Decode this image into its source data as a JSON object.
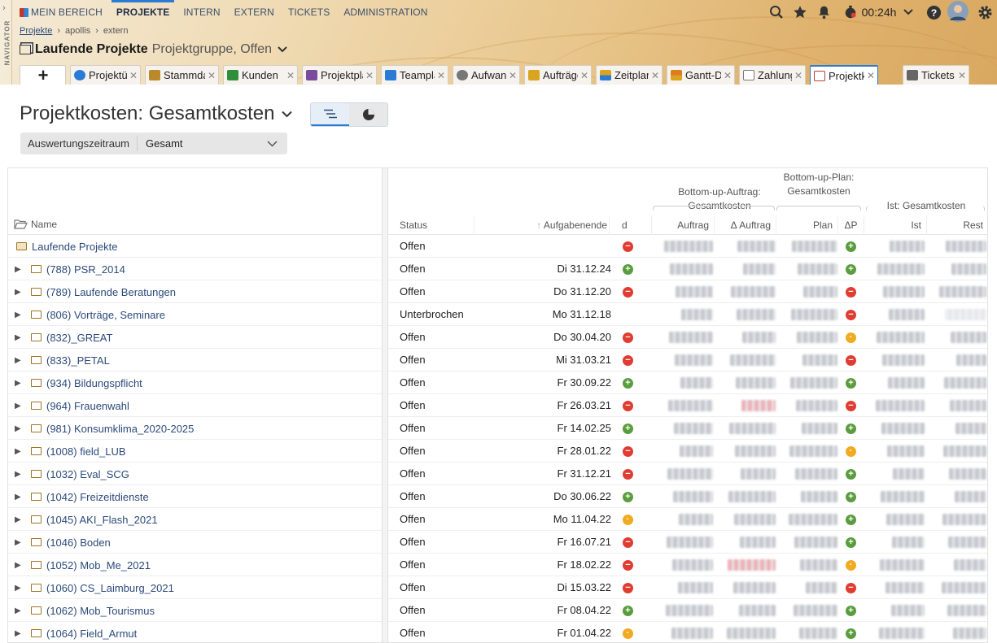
{
  "navigator": {
    "label": "NAVIGATOR"
  },
  "menu": [
    {
      "label": "MEIN BEREICH",
      "active": false
    },
    {
      "label": "PROJEKTE",
      "active": true
    },
    {
      "label": "INTERN",
      "active": false
    },
    {
      "label": "EXTERN",
      "active": false
    },
    {
      "label": "TICKETS",
      "active": false
    },
    {
      "label": "ADMINISTRATION",
      "active": false
    }
  ],
  "header_right": {
    "timer": "00:24h"
  },
  "breadcrumb": [
    "Projekte",
    "apollis",
    "extern"
  ],
  "page_title": {
    "main": "Laufende Projekte",
    "sub": "Projektgruppe, Offen"
  },
  "tabs": [
    {
      "label": "Projektüb",
      "icon": "info-icon",
      "color": "#2a7bd6"
    },
    {
      "label": "Stammdate",
      "icon": "stack-icon",
      "color": "#b9892c"
    },
    {
      "label": "Kunden",
      "icon": "building-icon",
      "color": "#2f8f3a"
    },
    {
      "label": "Projektplan",
      "icon": "tree-icon",
      "color": "#7a4a9c"
    },
    {
      "label": "Teamplan",
      "icon": "team-icon",
      "color": "#2a7bd6"
    },
    {
      "label": "Aufwand",
      "icon": "clock-icon",
      "color": "#555"
    },
    {
      "label": "Aufträge",
      "icon": "order-icon",
      "color": "#d9a520"
    },
    {
      "label": "Zeitplan",
      "icon": "schedule-icon",
      "color": "#d9a520"
    },
    {
      "label": "Gantt-Dia",
      "icon": "gantt-icon",
      "color": "#e07b1f"
    },
    {
      "label": "Zahlungen",
      "icon": "payment-icon",
      "color": "#555"
    },
    {
      "label": "Projektk",
      "icon": "cost-icon",
      "color": "#c0392b",
      "active": true
    },
    {
      "label": "Tickets",
      "icon": "tools-icon",
      "color": "#555"
    }
  ],
  "heading": "Projektkosten: Gesamtkosten",
  "filter": {
    "label": "Auswertungszeitraum",
    "value": "Gesamt"
  },
  "table": {
    "headers": {
      "name": "Name",
      "status": "Status",
      "end": "Aufgabenende",
      "d": "d",
      "auftrag": "Auftrag",
      "d_auftrag": "Δ Auftrag",
      "plan": "Plan",
      "dp": "ΔP",
      "ist": "Ist",
      "rest": "Rest"
    },
    "groups": {
      "bottom_up_auftrag": "Bottom-up-Auftrag: Gesamtkosten",
      "bottom_up_plan": "Bottom-up-Plan: Gesamtkosten",
      "ist": "Ist: Gesamtkosten"
    },
    "rows": [
      {
        "name": "Laufende Projekte",
        "status": "Offen",
        "date": "",
        "d": "minus",
        "dp": "plus",
        "root": true
      },
      {
        "name": "(788) PSR_2014",
        "status": "Offen",
        "date": "Di 31.12.24",
        "d": "plus",
        "dp": "plus"
      },
      {
        "name": "(789) Laufende Beratungen",
        "status": "Offen",
        "date": "Do 31.12.20",
        "d": "minus",
        "dp": "minus"
      },
      {
        "name": "(806) Vorträge, Seminare",
        "status": "Unterbrochen",
        "date": "Mo 31.12.18",
        "d": "",
        "dp": "minus"
      },
      {
        "name": "(832)_GREAT",
        "status": "Offen",
        "date": "Do 30.04.20",
        "d": "minus",
        "dp": "warn"
      },
      {
        "name": "(833)_PETAL",
        "status": "Offen",
        "date": "Mi 31.03.21",
        "d": "minus",
        "dp": "minus"
      },
      {
        "name": "(934) Bildungspflicht",
        "status": "Offen",
        "date": "Fr 30.09.22",
        "d": "plus",
        "dp": "plus"
      },
      {
        "name": "(964) Frauenwahl",
        "status": "Offen",
        "date": "Fr 26.03.21",
        "d": "minus",
        "dp": "minus",
        "neg": true
      },
      {
        "name": "(981) Konsumklima_2020-2025",
        "status": "Offen",
        "date": "Fr 14.02.25",
        "d": "plus",
        "dp": "plus"
      },
      {
        "name": "(1008) field_LUB",
        "status": "Offen",
        "date": "Fr 28.01.22",
        "d": "minus",
        "dp": "warn"
      },
      {
        "name": "(1032) Eval_SCG",
        "status": "Offen",
        "date": "Fr 31.12.21",
        "d": "minus",
        "dp": "plus"
      },
      {
        "name": "(1042) Freizeitdienste",
        "status": "Offen",
        "date": "Do 30.06.22",
        "d": "plus",
        "dp": "plus"
      },
      {
        "name": "(1045) AKI_Flash_2021",
        "status": "Offen",
        "date": "Mo 11.04.22",
        "d": "warn",
        "dp": "plus"
      },
      {
        "name": "(1046) Boden",
        "status": "Offen",
        "date": "Fr 16.07.21",
        "d": "minus",
        "dp": "plus"
      },
      {
        "name": "(1052) Mob_Me_2021",
        "status": "Offen",
        "date": "Fr 18.02.22",
        "d": "minus",
        "dp": "warn",
        "neg": true
      },
      {
        "name": "(1060) CS_Laimburg_2021",
        "status": "Offen",
        "date": "Di 15.03.22",
        "d": "minus",
        "dp": "minus"
      },
      {
        "name": "(1062) Mob_Tourismus",
        "status": "Offen",
        "date": "Fr 08.04.22",
        "d": "plus",
        "dp": "plus"
      },
      {
        "name": "(1064) Field_Armut",
        "status": "Offen",
        "date": "Fr 01.04.22",
        "d": "warn",
        "dp": "plus"
      }
    ]
  }
}
